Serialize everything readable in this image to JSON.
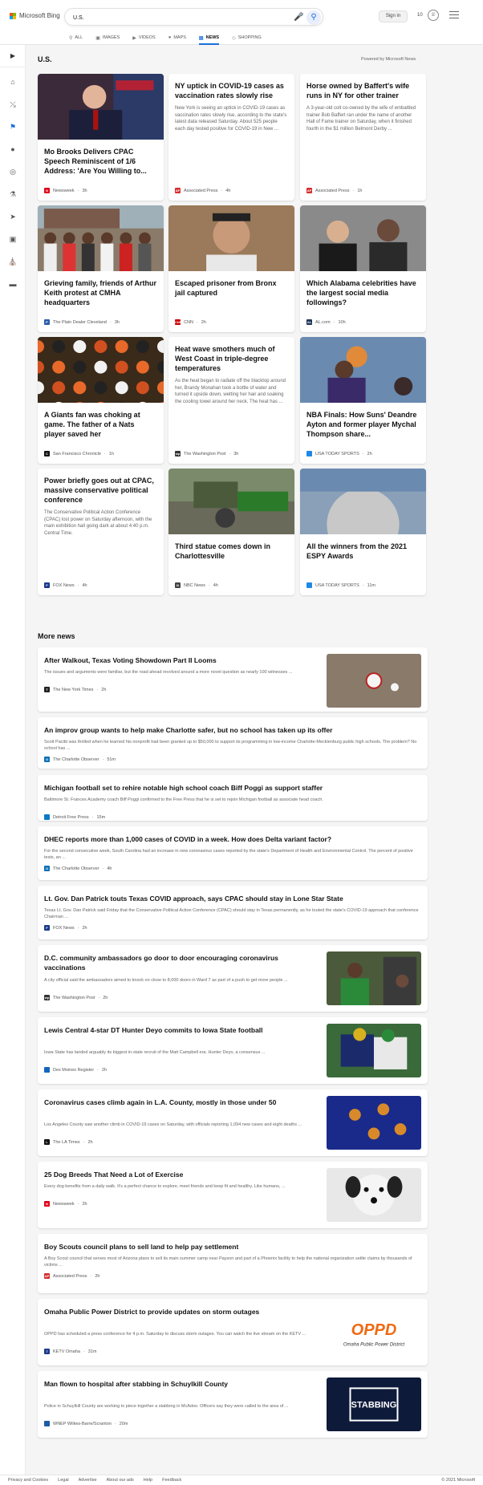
{
  "brand": {
    "name": "Microsoft Bing"
  },
  "search": {
    "value": "U.S.",
    "mic_icon": "microphone-icon",
    "search_icon": "search-icon"
  },
  "header": {
    "sign_in": "Sign in",
    "rewards": "10"
  },
  "tabs": [
    {
      "label": "ALL",
      "icon": "search-icon",
      "active": false
    },
    {
      "label": "IMAGES",
      "icon": "image-icon",
      "active": false
    },
    {
      "label": "VIDEOS",
      "icon": "video-icon",
      "active": false
    },
    {
      "label": "MAPS",
      "icon": "map-pin-icon",
      "active": false
    },
    {
      "label": "NEWS",
      "icon": "news-icon",
      "active": true
    },
    {
      "label": "SHOPPING",
      "icon": "shopping-tag-icon",
      "active": false
    }
  ],
  "section": {
    "title": "U.S.",
    "powered_by": "Powered by Microsoft News"
  },
  "cards": [
    {
      "title": "Mo Brooks Delivers CPAC Speech Reminiscent of 1/6 Address: 'Are You Willing to...",
      "desc": "",
      "source": "Newsweek",
      "time": "3h",
      "src_color": "#e0001b",
      "src_letter": "N",
      "img": "politician"
    },
    {
      "title": "NY uptick in COVID-19 cases as vaccination rates slowly rise",
      "desc": "New York is seeing an uptick in COVID-19 cases as vaccination rates slowly rise, according to the state's latest data released Saturday. About 525 people each day tested positive for COVID-19 in New ...",
      "source": "Associated Press",
      "time": "4h",
      "src_color": "#d32f2f",
      "src_letter": "AP",
      "img": ""
    },
    {
      "title": "Horse owned by Baffert's wife runs in NY for other trainer",
      "desc": "A 3-year-old colt co-owned by the wife of embattled trainer Bob Baffert ran under the name of another Hall of Fame trainer on Saturday, when it finished fourth in the $1 million Belmont Derby ...",
      "source": "Associated Press",
      "time": "1h",
      "src_color": "#d32f2f",
      "src_letter": "AP",
      "img": ""
    },
    {
      "title": "Grieving family, friends of Arthur Keith protest at CMHA headquarters",
      "desc": "",
      "source": "The Plain Dealer Cleveland",
      "time": "3h",
      "src_color": "#2a5da8",
      "src_letter": "P",
      "img": "protest"
    },
    {
      "title": "Escaped prisoner from Bronx jail captured",
      "desc": "",
      "source": "CNN",
      "time": "2h",
      "src_color": "#cc0000",
      "src_letter": "CNN",
      "img": "mugshot"
    },
    {
      "title": "Which Alabama celebrities have the largest social media followings?",
      "desc": "",
      "source": "AL.com",
      "time": "10h",
      "src_color": "#1d3557",
      "src_letter": "AL",
      "img": "celebs"
    },
    {
      "title": "A Giants fan was choking at game. The father of a Nats player saved her",
      "desc": "",
      "source": "San Francisco Chronicle",
      "time": "1h",
      "src_color": "#111111",
      "src_letter": "C",
      "img": "crowd"
    },
    {
      "title": "Heat wave smothers much of West Coast in triple-degree temperatures",
      "desc": "As the heat began to radiate off the blacktop around her, Brandy Monahan took a bottle of water and turned it upside down, wetting her hair and soaking the cooling towel around her neck. The heat has ...",
      "source": "The Washington Post",
      "time": "3h",
      "src_color": "#333333",
      "src_letter": "wp",
      "img": ""
    },
    {
      "title": "NBA Finals: How Suns' Deandre Ayton and former player Mychal Thompson share...",
      "desc": "",
      "source": "USA TODAY SPORTS",
      "time": "2h",
      "src_color": "#1e88e5",
      "src_letter": "",
      "img": "basketball"
    },
    {
      "title": "Power briefly goes out at CPAC, massive conservative political conference",
      "desc": "The Conservative Political Action Conference (CPAC) lost power on Saturday afternoon, with the main exhibition hall going dark at about 4:40 p.m. Central Time.",
      "source": "FOX News",
      "time": "4h",
      "src_color": "#1a3a8c",
      "src_letter": "F",
      "img": ""
    },
    {
      "title": "Third statue comes down in Charlottesville",
      "desc": "",
      "source": "NBC News",
      "time": "4h",
      "src_color": "#444444",
      "src_letter": "N",
      "img": "statue"
    },
    {
      "title": "All the winners from the 2021 ESPY Awards",
      "desc": "",
      "source": "USA TODAY SPORTS",
      "time": "11m",
      "src_color": "#1e88e5",
      "src_letter": "",
      "img": "sphere"
    }
  ],
  "more": {
    "title": "More news"
  },
  "rows": [
    {
      "title": "After Walkout, Texas Voting Showdown Part II Looms",
      "desc": "The issues and arguments were familiar, but the road ahead revolved around a more novel question as nearly 100 witnesses ...",
      "source": "The New York Times",
      "time": "2h",
      "src_color": "#222222",
      "src_letter": "T",
      "img": "vote"
    },
    {
      "title": "An improv group wants to help make Charlotte safer, but no school has taken up its offer",
      "desc": "Scott Pacitti was thrilled when he learned his nonprofit had been granted up to $50,000 to support its programming in low-income Charlotte-Mecklenburg public high schools. The problem? No school has ...",
      "source": "The Charlotte Observer",
      "time": "51m",
      "src_color": "#0d6fb8",
      "src_letter": "O",
      "img": ""
    },
    {
      "title": "Michigan football set to rehire notable high school coach Biff Poggi as support staffer",
      "desc": "Baltimore St. Frances Academy coach Biff Poggi confirmed to the Free Press that he is set to rejoin Michigan football as associate head coach.",
      "source": "Detroit Free Press",
      "time": "15m",
      "src_color": "#0a7ac4",
      "src_letter": "",
      "img": ""
    },
    {
      "title": "DHEC reports more than 1,000 cases of COVID in a week. How does Delta variant factor?",
      "desc": "For the second consecutive week, South Carolina had an increase in new coronavirus cases reported by the state's Department of Health and Environmental Control. The percent of positive tests, an ...",
      "source": "The Charlotte Observer",
      "time": "4h",
      "src_color": "#0d6fb8",
      "src_letter": "O",
      "img": ""
    },
    {
      "title": "Lt. Gov. Dan Patrick touts Texas COVID approach, says CPAC should stay in Lone Star State",
      "desc": "Texas Lt. Gov. Dan Patrick said Friday that the Conservative Political Action Conference (CPAC) should stay in Texas permanently, as he touted the state's COVID-19 approach that conference Chairman ...",
      "source": "FOX News",
      "time": "2h",
      "src_color": "#1a3a8c",
      "src_letter": "F",
      "img": ""
    },
    {
      "title": "D.C. community ambassadors go door to door encouraging coronavirus vaccinations",
      "desc": "A city official said the ambassadors aimed to knock on close to 8,000 doors in Ward 7 as part of a push to get more people ...",
      "source": "The Washington Post",
      "time": "2h",
      "src_color": "#333333",
      "src_letter": "wp",
      "img": "door"
    },
    {
      "title": "Lewis Central 4-star DT Hunter Deyo commits to Iowa State football",
      "desc": "Iowa State has landed arguably its biggest in-state recruit of the Matt Campbell era. Hunter Deyo, a consensus ...",
      "source": "Des Moines Register",
      "time": "2h",
      "src_color": "#1565c0",
      "src_letter": "",
      "img": "football"
    },
    {
      "title": "Coronavirus cases climb again in L.A. County, mostly in those under 50",
      "desc": "Los Angeles County saw another climb in COVID-19 cases on Saturday, with officials reporting 1,094 new cases and eight deaths ...",
      "source": "The LA Times",
      "time": "2h",
      "src_color": "#111111",
      "src_letter": "L",
      "img": "virus"
    },
    {
      "title": "25 Dog Breeds That Need a Lot of Exercise",
      "desc": "Every dog benefits from a daily walk. It's a perfect chance to explore, meet friends and keep fit and healthy. Like humans, ...",
      "source": "Newsweek",
      "time": "2h",
      "src_color": "#e0001b",
      "src_letter": "N",
      "img": "dog"
    },
    {
      "title": "Boy Scouts council plans to sell land to help pay settlement",
      "desc": "A Boy Scout council that serves most of Arizona plans to sell its main summer camp near Payson and part of a Phoenix facility to help the national organization settle claims by thousands of victims ...",
      "source": "Associated Press",
      "time": "2h",
      "src_color": "#d32f2f",
      "src_letter": "AP",
      "img": ""
    },
    {
      "title": "Omaha Public Power District to provide updates on storm outages",
      "desc": "OPPD has scheduled a press conference for 4 p.m. Saturday to discuss storm outages. You can watch the live stream on the KETV ...",
      "source": "KETV Omaha",
      "time": "31m",
      "src_color": "#1a3a8c",
      "src_letter": "7",
      "img": "oppd",
      "img_text": "OPPD",
      "img_sub": "Omaha Public Power District"
    },
    {
      "title": "Man flown to hospital after stabbing in Schuylkill County",
      "desc": "Police in Schuylkill County are working to piece together a stabbing in McAdoo. Officers say they were called to the area of ...",
      "source": "WNEP Wilkes-Barre/Scranton",
      "time": "20m",
      "src_color": "#1e5aa8",
      "src_letter": "",
      "img": "stabbing",
      "img_text": "STABBING"
    }
  ],
  "footer": {
    "links": [
      "Privacy and Cookies",
      "Legal",
      "Advertise",
      "About our ads",
      "Help",
      "Feedback"
    ],
    "copyright": "© 2021 Microsoft"
  }
}
